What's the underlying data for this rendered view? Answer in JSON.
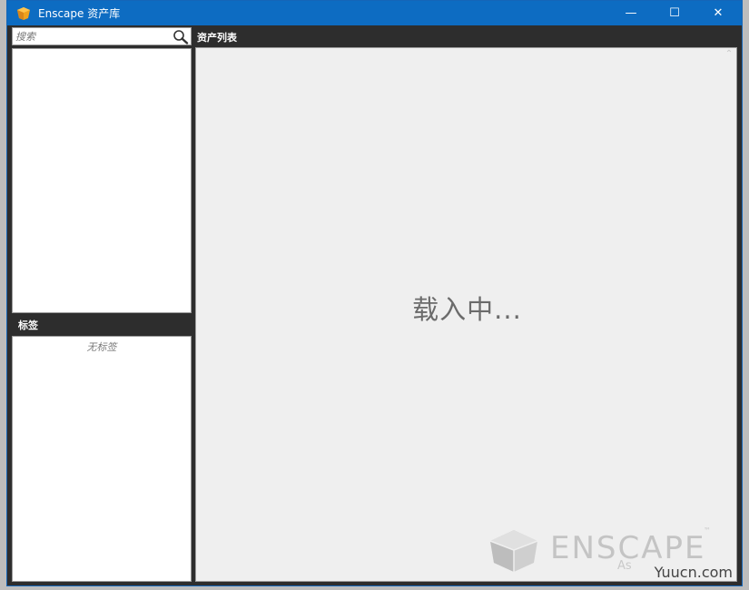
{
  "window": {
    "title": "Enscape 资产库",
    "controls": {
      "minimize": "—",
      "maximize": "☐",
      "close": "✕"
    }
  },
  "sidebar": {
    "search": {
      "placeholder": "搜索",
      "value": ""
    },
    "tags": {
      "header": "标签",
      "empty_text": "无标签"
    }
  },
  "main": {
    "header": "资产列表",
    "loading_text": "载入中..."
  },
  "watermark": {
    "brand": "ENSCAPE",
    "trademark": "™",
    "sub": "As"
  },
  "site_watermark": "Yuucn.com",
  "colors": {
    "titlebar": "#0d6cc2",
    "panel_dark": "#2d2d2d",
    "list_bg": "#efefef",
    "logo_orange": "#f0a21e"
  }
}
